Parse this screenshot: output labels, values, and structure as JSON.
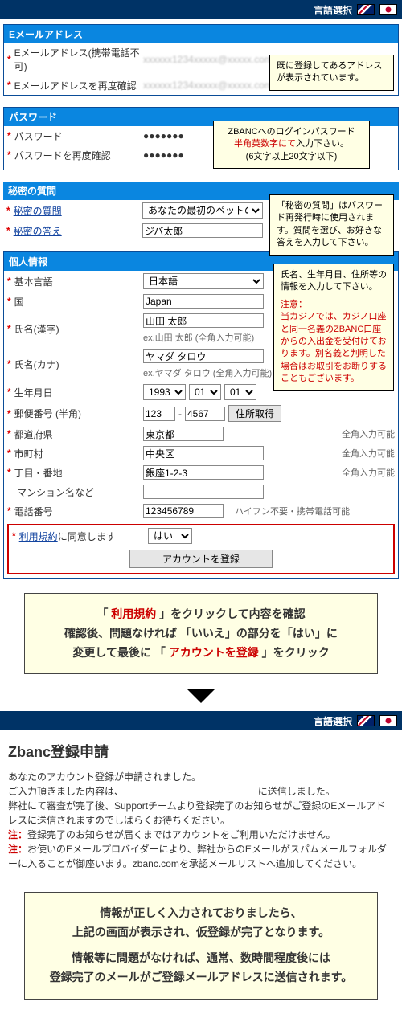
{
  "topbar": {
    "langLabel": "言語選択"
  },
  "sec": {
    "email": {
      "title": "Eメールアドレス",
      "l1": "Eメールアドレス(携帯電話不可)",
      "l2": "Eメールアドレスを再度確認"
    },
    "pass": {
      "title": "パスワード",
      "l1": "パスワード",
      "l2": "パスワードを再度確認",
      "dots": "●●●●●●●"
    },
    "secret": {
      "title": "秘密の質問",
      "l1": "秘密の質問",
      "l2": "秘密の答え",
      "qVal": "あなたの最初のペットの名前は？",
      "aVal": "ジバ太郎"
    },
    "info": {
      "title": "個人情報",
      "l_lang": "基本言語",
      "v_lang": "日本語",
      "l_country": "国",
      "v_country": "Japan",
      "l_namek": "氏名(漢字)",
      "v_namek": "山田 太郎",
      "h_namek": "ex.山田 太郎 (全角入力可能)",
      "l_namekn": "氏名(カナ)",
      "v_namekn": "ヤマダ タロウ",
      "h_namekn": "ex.ヤマダ タロウ (全角入力可能)",
      "l_birth": "生年月日",
      "v_by": "1993",
      "v_bm": "01",
      "v_bd": "01",
      "l_post": "郵便番号 (半角)",
      "v_p1": "123",
      "v_p2": "4567",
      "btn_post": "住所取得",
      "l_pref": "都道府県",
      "v_pref": "東京都",
      "h_pref": "全角入力可能",
      "l_city": "市町村",
      "v_city": "中央区",
      "h_city": "全角入力可能",
      "l_addr": "丁目・番地",
      "v_addr": "銀座1-2-3",
      "h_addr": "全角入力可能",
      "l_bldg": "マンション名など",
      "l_tel": "電話番号",
      "v_tel": "123456789",
      "h_tel": "ハイフン不要・携帯電話可能",
      "l_terms_pre": "利用規約",
      "l_terms_post": "に同意します",
      "v_terms": "はい",
      "btn_register": "アカウントを登録"
    }
  },
  "callouts": {
    "email": "既に登録してあるアドレスが表示されています。",
    "pass": {
      "l1": "ZBANCへのログインパスワード",
      "l2": "半角英数字にて",
      "l2b": "入力下さい。",
      "l3": "(6文字以上20文字以下)"
    },
    "secret": "「秘密の質問」はパスワード再発行時に使用されます。質問を選び、お好きな答えを入力して下さい。",
    "info": {
      "l1": "氏名、生年月日、住所等の情報を入力して下さい。",
      "l2": "注意：",
      "l3": "当カジノでは、カジノ口座と同一名義のZBANC口座からの入出金を受付けております。別名義と判明した場合はお取引をお断りすることもございます。"
    }
  },
  "bignote1": {
    "l1a": "「 ",
    "l1b": "利用規約",
    "l1c": " 」をクリックして内容を確認",
    "l2a": "確認後、問題なければ 「いいえ」の部分を「はい」に",
    "l3a": "変更して最後に 「 ",
    "l3b": "アカウントを登録",
    "l3c": " 」をクリック"
  },
  "post": {
    "heading": "Zbanc登録申請",
    "p1": "あなたのアカウント登録が申請されました。",
    "p2a": "ご入力頂きました内容は、",
    "p2b": "に送信しました。",
    "p3": "弊社にて審査が完了後、Supportチームより登録完了のお知らせがご登録のEメールアドレスに送信されますのでしばらくお待ちください。",
    "p4": "登録完了のお知らせが届くまではアカウントをご利用いただけません。",
    "p5": "お使いのEメールプロバイダーにより、弊社からのEメールがスパムメールフォルダーに入ることが御座います。zbanc.comを承認メールリストへ追加してください。",
    "note": "注："
  },
  "bignote2": {
    "l1": "情報が正しく入力されておりましたら、",
    "l2": "上記の画面が表示され、仮登録が完了となります。",
    "l3": "情報等に問題がなければ、通常、数時間程度後には",
    "l4": "登録完了のメールがご登録メールアドレスに送信されます。"
  }
}
